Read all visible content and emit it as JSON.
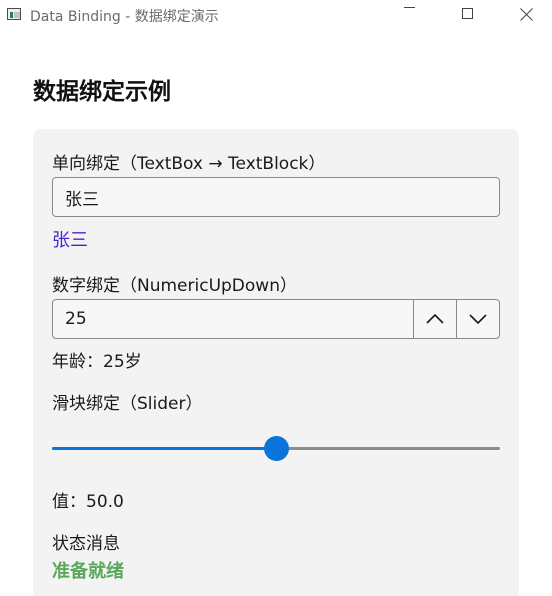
{
  "window": {
    "title": "Data Binding - 数据绑定演示",
    "icon": "app-window-icon",
    "controls": [
      "minimize-icon",
      "maximize-icon",
      "close-icon"
    ]
  },
  "page": {
    "title": "数据绑定示例"
  },
  "one_way": {
    "label": "单向绑定（TextBox → TextBlock）",
    "input_value": "张三",
    "bound_text": "张三",
    "bound_text_color": "#4b1fd1"
  },
  "numeric": {
    "label": "数字绑定（NumericUpDown）",
    "value": "25",
    "result_text": "年龄：25岁",
    "up_icon": "chevron-up-icon",
    "down_icon": "chevron-down-icon"
  },
  "slider": {
    "label": "滑块绑定（Slider）",
    "level_fraction": 0.5,
    "value_text": "值：50.0",
    "accent_color": "#0a74da"
  },
  "status": {
    "label": "状态消息",
    "message": "准备就绪",
    "message_color": "#5aa85a"
  }
}
